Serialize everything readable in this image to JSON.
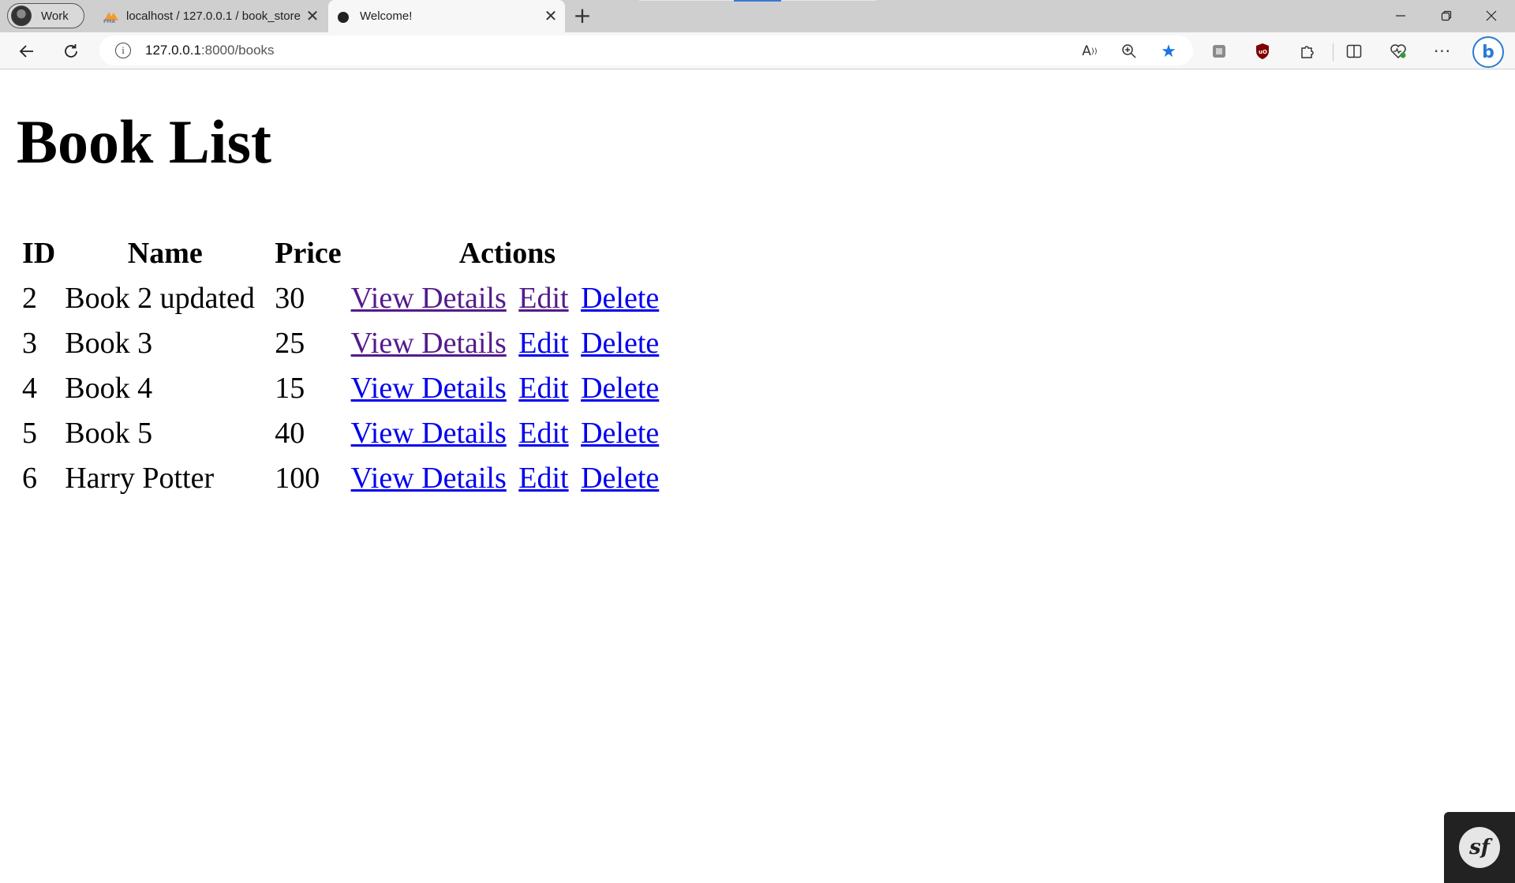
{
  "browser": {
    "profile": {
      "label": "Work"
    },
    "tabs": [
      {
        "title": "localhost / 127.0.0.1 / book_store",
        "favicon": "phpmyadmin-icon",
        "close": "✕"
      },
      {
        "title": "Welcome!",
        "favicon": "symfony-circle-icon",
        "close": "✕"
      }
    ],
    "new_tab": "+",
    "window_controls": {
      "minimize": "—",
      "maximize": "❐",
      "close": "✕"
    },
    "toolbar": {
      "back": "←",
      "reload": "↻",
      "info": "i",
      "url_host": "127.0.0.1",
      "url_rest": ":8000/books",
      "read_aloud": "A",
      "favorite": "★",
      "more": "···",
      "copilot": "b"
    }
  },
  "page": {
    "title": "Book List",
    "table": {
      "headers": {
        "id": "ID",
        "name": "Name",
        "price": "Price",
        "actions": "Actions"
      },
      "rows": [
        {
          "id": "2",
          "name": "Book 2 updated",
          "price": "30",
          "view": "View Details",
          "edit": "Edit",
          "delete": "Delete"
        },
        {
          "id": "3",
          "name": "Book 3",
          "price": "25",
          "view": "View Details",
          "edit": "Edit",
          "delete": "Delete"
        },
        {
          "id": "4",
          "name": "Book 4",
          "price": "15",
          "view": "View Details",
          "edit": "Edit",
          "delete": "Delete"
        },
        {
          "id": "5",
          "name": "Book 5",
          "price": "40",
          "view": "View Details",
          "edit": "Edit",
          "delete": "Delete"
        },
        {
          "id": "6",
          "name": "Harry Potter",
          "price": "100",
          "view": "View Details",
          "edit": "Edit",
          "delete": "Delete"
        }
      ]
    },
    "link_colors": {
      "unvisited": "#0000ee",
      "visited": "#551a8b"
    }
  },
  "symfony_toolbar": {
    "logo": "sf"
  }
}
